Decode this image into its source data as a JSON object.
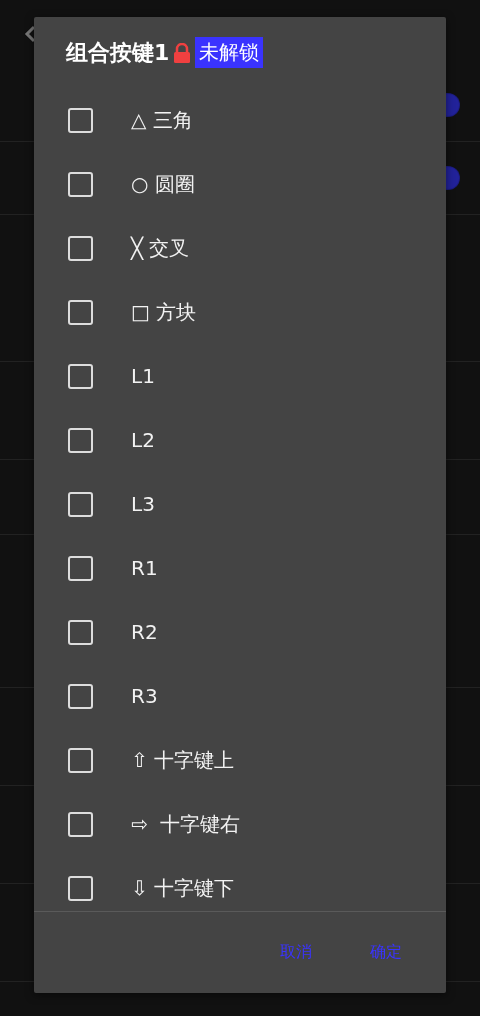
{
  "background": {
    "rows": [
      {
        "kind": "toggle",
        "on": true
      },
      {
        "kind": "toggle",
        "on": true
      },
      {
        "kind": "plain"
      },
      {
        "kind": "plain"
      },
      {
        "kind": "plain"
      },
      {
        "kind": "section"
      },
      {
        "kind": "plain"
      },
      {
        "kind": "plain"
      },
      {
        "kind": "plain"
      },
      {
        "kind": "plain"
      }
    ]
  },
  "dialog": {
    "title": "组合按键1",
    "locked": true,
    "badge": "未解锁",
    "items": [
      {
        "label": "△ 三角",
        "checked": false
      },
      {
        "label": "○ 圆圈",
        "checked": false
      },
      {
        "label": "╳ 交叉",
        "checked": false
      },
      {
        "label": "□ 方块",
        "checked": false
      },
      {
        "label": "L1",
        "checked": false
      },
      {
        "label": "L2",
        "checked": false
      },
      {
        "label": "L3",
        "checked": false
      },
      {
        "label": "R1",
        "checked": false
      },
      {
        "label": "R2",
        "checked": false
      },
      {
        "label": "R3",
        "checked": false
      },
      {
        "label": "⇧ 十字键上",
        "checked": false
      },
      {
        "label": "⇨  十字键右",
        "checked": false
      },
      {
        "label": "⇩ 十字键下",
        "checked": false
      }
    ],
    "buttons": [
      "取消",
      "确定"
    ]
  }
}
